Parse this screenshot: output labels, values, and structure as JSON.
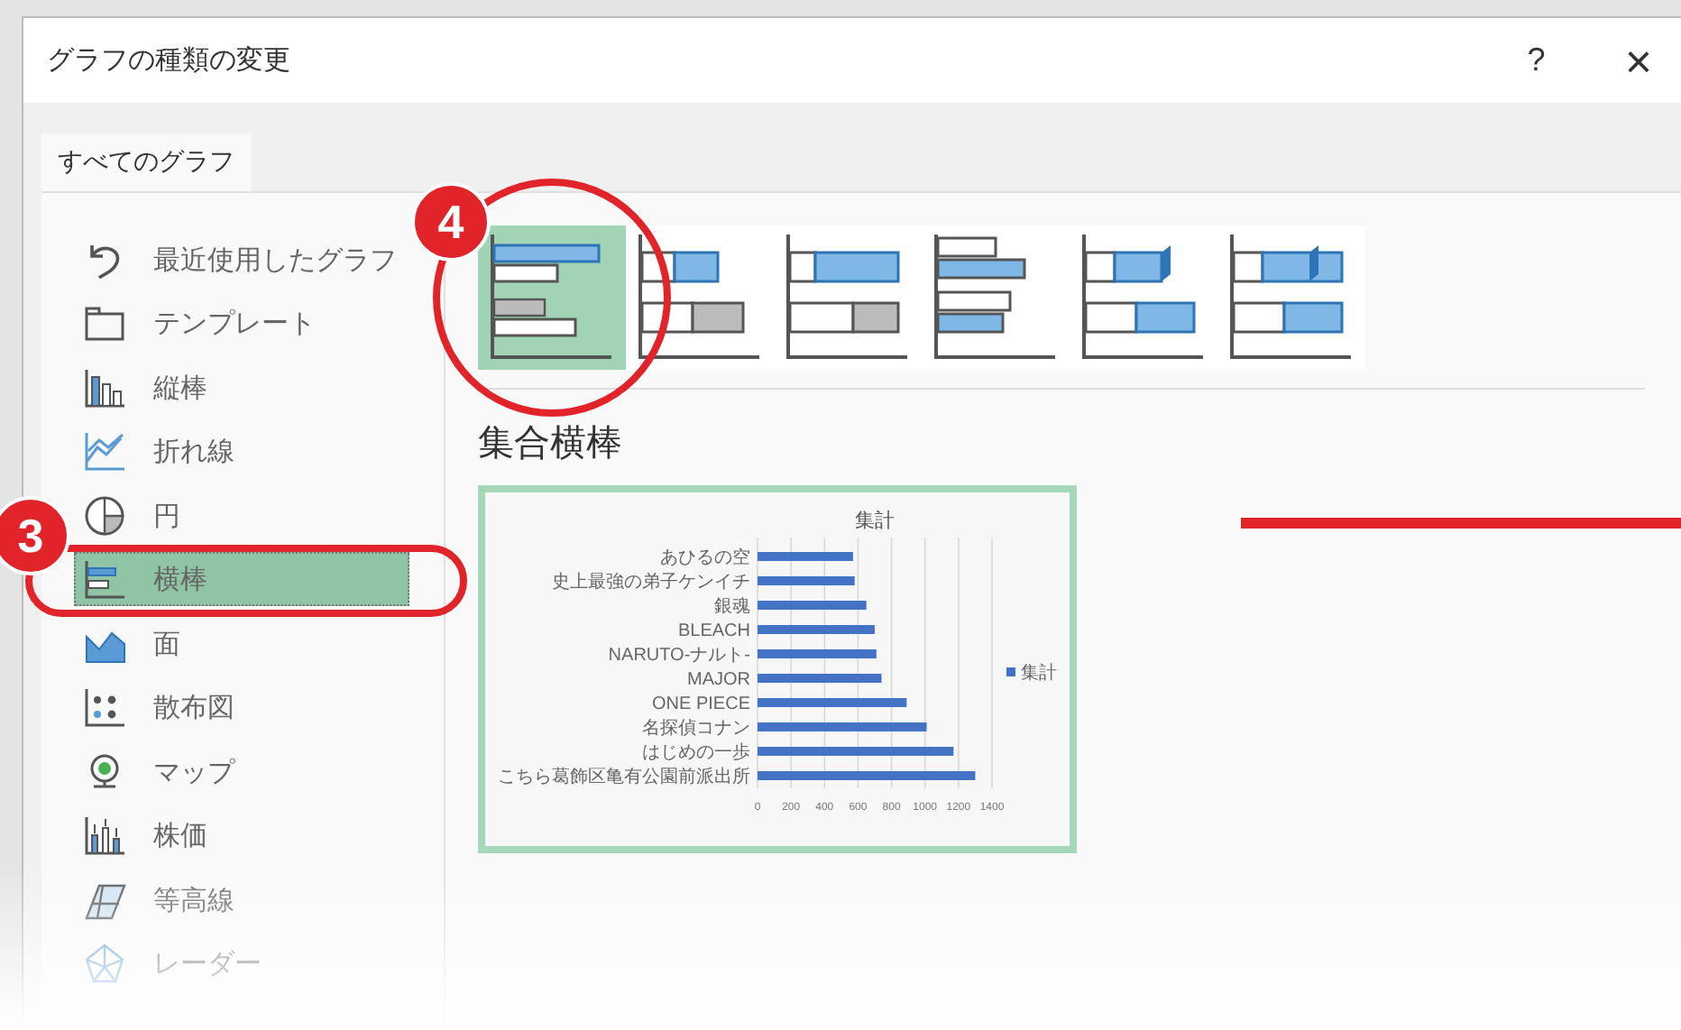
{
  "window": {
    "title": "グラフの種類の変更",
    "help": "?",
    "close": "×"
  },
  "tabs": [
    {
      "label": "すべてのグラフ",
      "selected": true
    }
  ],
  "sidebar": {
    "items": [
      {
        "label": "最近使用したグラフ",
        "selected": false
      },
      {
        "label": "テンプレート",
        "selected": false
      },
      {
        "label": "縦棒",
        "selected": false
      },
      {
        "label": "折れ線",
        "selected": false
      },
      {
        "label": "円",
        "selected": false
      },
      {
        "label": "横棒",
        "selected": true
      },
      {
        "label": "面",
        "selected": false
      },
      {
        "label": "散布図",
        "selected": false
      },
      {
        "label": "マップ",
        "selected": false
      },
      {
        "label": "株価",
        "selected": false
      },
      {
        "label": "等高線",
        "selected": false
      },
      {
        "label": "レーダー",
        "selected": false
      }
    ]
  },
  "subtypes": [
    {
      "selected": true
    },
    {
      "selected": false
    },
    {
      "selected": false
    },
    {
      "selected": false
    },
    {
      "selected": false
    },
    {
      "selected": false
    }
  ],
  "subtype_title": "集合横棒",
  "preview": {
    "chart_data": {
      "type": "bar",
      "orientation": "horizontal",
      "title": "集計",
      "categories": [
        "あひるの空",
        "史上最強の弟子ケンイチ",
        "銀魂",
        "BLEACH",
        "NARUTO-ナルト-",
        "MAJOR",
        "ONE PIECE",
        "名探偵コナン",
        "はじめの一歩",
        "こちら葛飾区亀有公園前派出所"
      ],
      "series": [
        {
          "name": "集計",
          "color": "#4472c4",
          "values": [
            570,
            580,
            650,
            700,
            710,
            740,
            890,
            1010,
            1170,
            1300
          ]
        }
      ],
      "xlim": [
        0,
        1400
      ],
      "grid": true,
      "xticks": [
        0,
        200,
        400,
        600,
        800,
        1000,
        1200,
        1400
      ]
    }
  },
  "annotations": [
    {
      "kind": "badge",
      "label": "4"
    },
    {
      "kind": "badge",
      "label": "3"
    }
  ]
}
